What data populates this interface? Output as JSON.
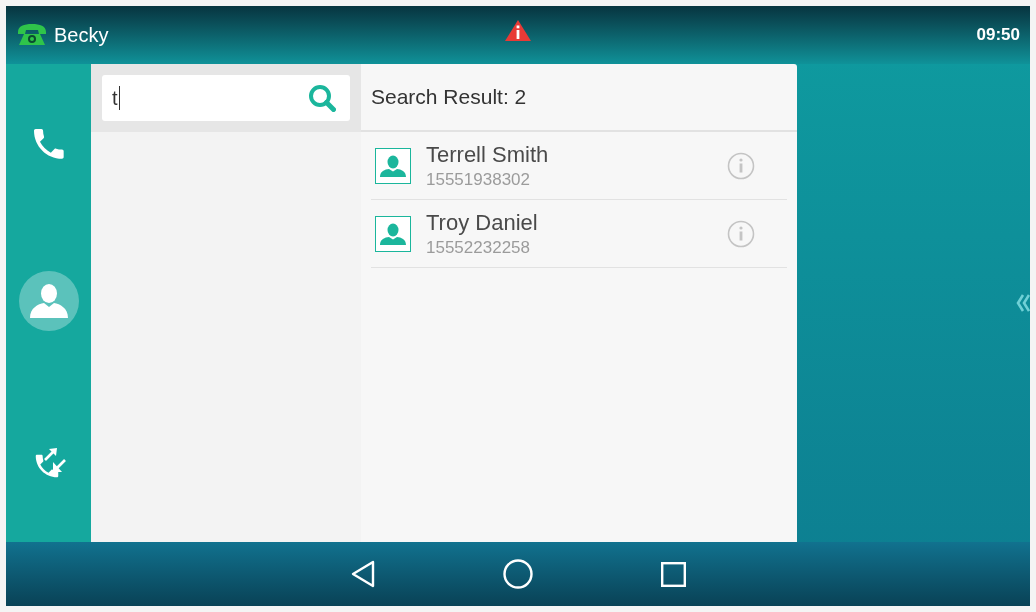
{
  "status_bar": {
    "account": "Becky",
    "time": "09:50"
  },
  "sidebar": {
    "items": [
      {
        "kind": "phone",
        "selected": false
      },
      {
        "kind": "contacts",
        "selected": true
      },
      {
        "kind": "transfer",
        "selected": false
      }
    ]
  },
  "search": {
    "value": "t"
  },
  "results": {
    "title": "Search Result: 2",
    "contacts": [
      {
        "name": "Terrell Smith",
        "number": "15551938302"
      },
      {
        "name": "Troy Daniel",
        "number": "15552232258"
      }
    ]
  }
}
